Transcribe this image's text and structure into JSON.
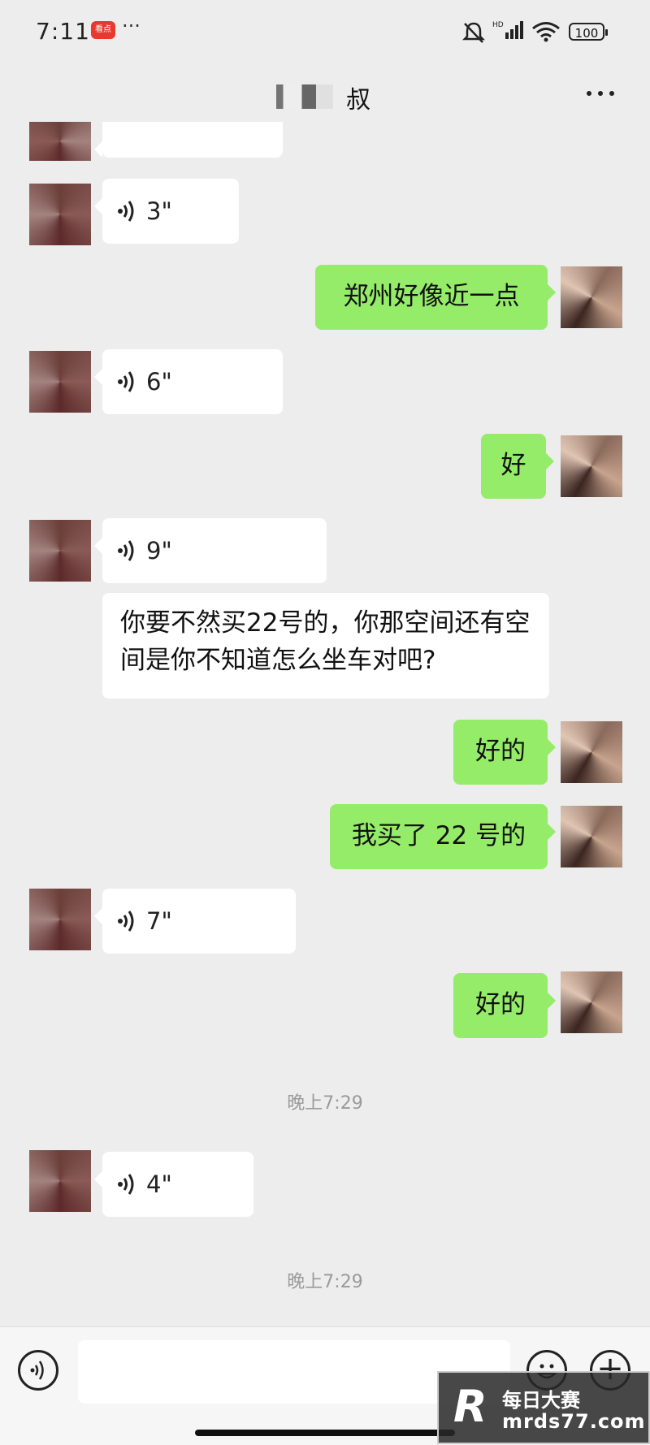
{
  "status_bar": {
    "time": "7:11",
    "notification_app_label": "看点",
    "more_dots": "···",
    "battery": "100"
  },
  "header": {
    "title": "叔",
    "more_icon": "more-dots-icon"
  },
  "messages": [
    {
      "side": "in",
      "type": "voice",
      "duration": "3\""
    },
    {
      "side": "out",
      "type": "text",
      "text": "郑州好像近一点"
    },
    {
      "side": "in",
      "type": "voice",
      "duration": "6\""
    },
    {
      "side": "out",
      "type": "text",
      "text": "好"
    },
    {
      "side": "in",
      "type": "voice",
      "duration": "9\""
    },
    {
      "side": "in",
      "type": "text",
      "text": "你要不然买22号的，你那空间还有空间是你不知道怎么坐车对吧?"
    },
    {
      "side": "out",
      "type": "text",
      "text": "好的"
    },
    {
      "side": "out",
      "type": "text",
      "text": "我买了 22 号的"
    },
    {
      "side": "in",
      "type": "voice",
      "duration": "7\""
    },
    {
      "side": "out",
      "type": "text",
      "text": "好的"
    },
    {
      "side": "system",
      "type": "timestamp",
      "text": "晚上7:29"
    },
    {
      "side": "in",
      "type": "voice",
      "duration": "4\""
    },
    {
      "side": "system",
      "type": "timestamp",
      "text": "晚上7:29"
    }
  ],
  "input_bar": {
    "voice_icon": "voice-input-icon",
    "emoji_icon": "emoji-icon",
    "plus_icon": "plus-icon",
    "input_value": ""
  },
  "watermark": {
    "logo": "R",
    "name": "每日大赛",
    "url": "mrds77.com"
  },
  "colors": {
    "background": "#ededed",
    "outgoing_bubble": "#95ec69",
    "incoming_bubble": "#ffffff",
    "timestamp_text": "#9a9a9a"
  }
}
